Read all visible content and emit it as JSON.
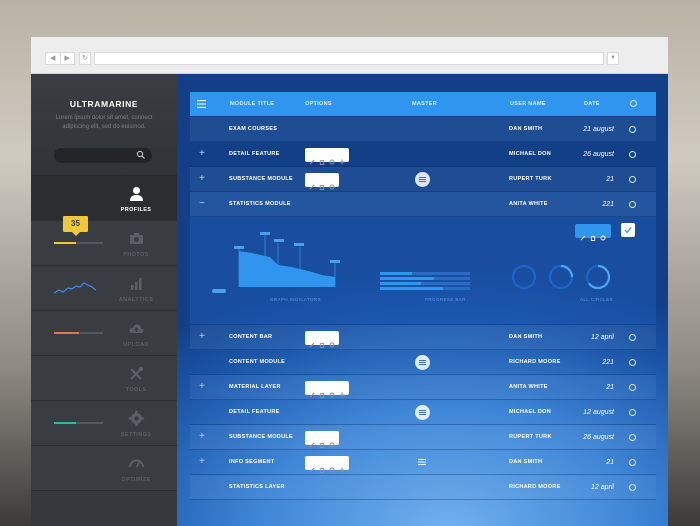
{
  "sidebar": {
    "brand": "ULTRAMARINE",
    "tagline": "Lorem ipsum dolor sit amet, connect adipiscing elit, sed do euismod.",
    "badge": "35",
    "nav": [
      {
        "label": "PROFILES",
        "icon": "user-icon",
        "active": true
      },
      {
        "label": "PHOTOS",
        "icon": "camera-icon",
        "progress": 0.45,
        "progress_color": "#f0c93a"
      },
      {
        "label": "ANALYTICS",
        "icon": "bar-chart-icon"
      },
      {
        "label": "UPLOAD",
        "icon": "cloud-upload-icon",
        "progress": 0.5,
        "progress_color": "#e2734a"
      },
      {
        "label": "TOOLS",
        "icon": "tools-icon"
      },
      {
        "label": "SETTINGS",
        "icon": "gear-icon",
        "progress": 0.45,
        "progress_color": "#2bbd9c"
      },
      {
        "label": "OPTIMIZE",
        "icon": "speedometer-icon"
      }
    ]
  },
  "table": {
    "headers": {
      "module_title": "MODULE TITLE",
      "options": "OPTIONS",
      "master": "MASTER",
      "user_name": "USER NAME",
      "date": "DATE"
    },
    "rows": [
      {
        "title": "EXAM COURSES",
        "user": "DAN SMITH",
        "date": "21 august",
        "plus": "",
        "options": 0,
        "master": "none"
      },
      {
        "title": "DETAIL FEATURE",
        "user": "MICHAEL DON",
        "date": "26 august",
        "plus": "+",
        "options": 4,
        "master": "none"
      },
      {
        "title": "SUBSTANCE MODULE",
        "user": "RUPERT TURK",
        "date": "21",
        "plus": "+",
        "options": 3,
        "master": "circle"
      },
      {
        "title": "STATISTICS MODULE",
        "user": "ANITA WHITE",
        "date": "221",
        "plus": "−",
        "options": 0,
        "master": "none"
      },
      {
        "title": "CONTENT BAR",
        "user": "DAN SMITH",
        "date": "12 april",
        "plus": "+",
        "options": 3,
        "master": "none"
      },
      {
        "title": "CONTENT MODULE",
        "user": "RICHARD MOORE",
        "date": "221",
        "plus": "",
        "options": 0,
        "master": "circle"
      },
      {
        "title": "MATERIAL LAYER",
        "user": "ANITA WHITE",
        "date": "21",
        "plus": "+",
        "options": 4,
        "master": "none"
      },
      {
        "title": "DETAIL FEATURE",
        "user": "MICHAEL DON",
        "date": "12 august",
        "plus": "",
        "options": 0,
        "master": "circle"
      },
      {
        "title": "SUBSTANCE MODULE",
        "user": "RUPERT TURK",
        "date": "26 august",
        "plus": "+",
        "options": 3,
        "master": "none"
      },
      {
        "title": "INFO SEGMENT",
        "user": "DAN SMITH",
        "date": "21",
        "plus": "+",
        "options": 4,
        "master": "plain"
      },
      {
        "title": "STATISTICS LAYER",
        "user": "RICHARD MOORE",
        "date": "12 april",
        "plus": "",
        "options": 0,
        "master": "none"
      }
    ]
  },
  "expanded": {
    "captions": [
      "GRAPH INDICATORS",
      "PROGRESS BAR",
      "ALL CIRCLES"
    ],
    "progress_bars": [
      0.35,
      0.6,
      0.45,
      0.7
    ],
    "circles": [
      0.0,
      0.25,
      0.65
    ]
  },
  "colors": {
    "accent": "#2f95ee",
    "sidebar": "#35383d"
  }
}
